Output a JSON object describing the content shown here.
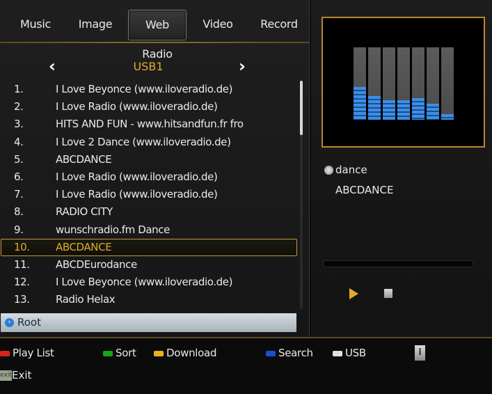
{
  "tabs": [
    {
      "label": "Music",
      "active": false
    },
    {
      "label": "Image",
      "active": false
    },
    {
      "label": "Web Radio",
      "active": true
    },
    {
      "label": "Video",
      "active": false
    },
    {
      "label": "Record",
      "active": false
    }
  ],
  "device": {
    "prev_icon": "chevron-left-icon",
    "label": "USB1",
    "next_icon": "chevron-right-icon"
  },
  "list": {
    "selected_index": 9,
    "items": [
      {
        "num": "1.",
        "name": "I Love Beyonce (www.iloveradio.de)"
      },
      {
        "num": "2.",
        "name": "I Love Radio (www.iloveradio.de)"
      },
      {
        "num": "3.",
        "name": "HITS AND FUN - www.hitsandfun.fr fro"
      },
      {
        "num": "4.",
        "name": "I Love 2 Dance (www.iloveradio.de)"
      },
      {
        "num": "5.",
        "name": "ABCDANCE"
      },
      {
        "num": "6.",
        "name": "I Love Radio (www.iloveradio.de)"
      },
      {
        "num": "7.",
        "name": "I Love Radio (www.iloveradio.de)"
      },
      {
        "num": "8.",
        "name": "RADIO CITY"
      },
      {
        "num": "9.",
        "name": "wunschradio.fm Dance"
      },
      {
        "num": "10.",
        "name": "ABCDANCE"
      },
      {
        "num": "11.",
        "name": "ABCDEurodance"
      },
      {
        "num": "12.",
        "name": "I Love Beyonce (www.iloveradio.de)"
      },
      {
        "num": "13.",
        "name": "Radio Helax"
      }
    ]
  },
  "root": {
    "label": "Root",
    "icon": "circle-arrow-icon"
  },
  "now_playing": {
    "genre": "dance",
    "station": "ABCDANCE",
    "equalizer_levels": [
      0.45,
      0.33,
      0.27,
      0.27,
      0.3,
      0.22,
      0.08
    ]
  },
  "colors": {
    "accent": "#e3aa2a",
    "red_key": "#e02020",
    "green_key": "#1aa01a",
    "yellow_key": "#e8b21a",
    "blue_key": "#1a4fd0",
    "white_key": "#e0e0e0"
  },
  "legend": {
    "play_list": "Play List",
    "sort": "Sort",
    "download": "Download",
    "search": "Search",
    "usb": "USB",
    "info": "i",
    "exit_key": "exit",
    "exit": "Exit"
  }
}
